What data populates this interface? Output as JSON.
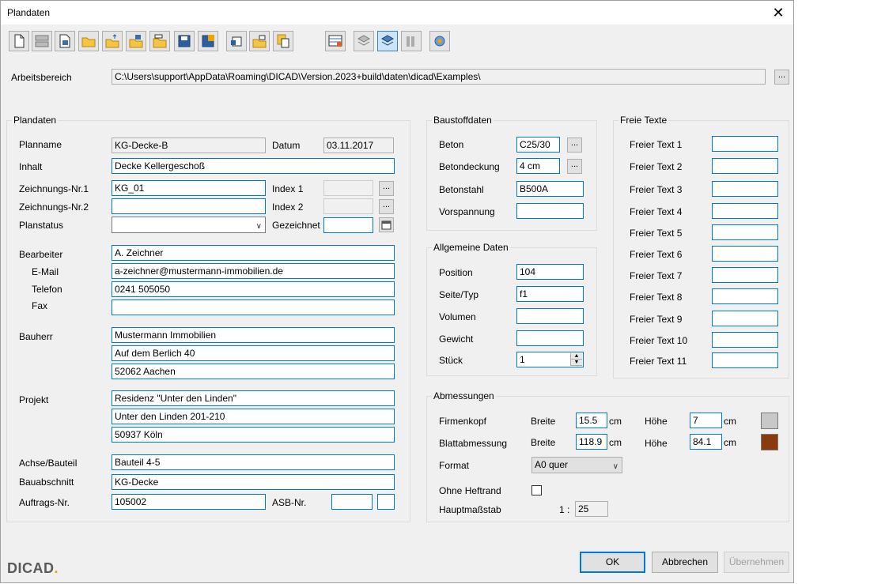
{
  "window": {
    "title": "Plandaten",
    "close_glyph": "✕"
  },
  "toolbar": {
    "icons": [
      "new-icon",
      "layout-icon",
      "document-icon",
      "open-folder-icon",
      "open-folder-up-icon",
      "open-folder-multi-icon",
      "open-folder-arrow-icon",
      "save-icon",
      "save-as-icon",
      "export-icon",
      "import-folder-icon",
      "copy-icon",
      "table-edit-icon",
      "stack-icon",
      "view-icon",
      "columns-icon",
      "settings-icon"
    ]
  },
  "arbeitsbereich": {
    "label": "Arbeitsbereich",
    "path": "C:\\Users\\support\\AppData\\Roaming\\DICAD\\Version.2023+build\\daten\\dicad\\Examples\\",
    "browse": "..."
  },
  "plandaten": {
    "title": "Plandaten",
    "planname_label": "Planname",
    "planname": "KG-Decke-B",
    "datum_label": "Datum",
    "datum": "03.11.2017",
    "inhalt_label": "Inhalt",
    "inhalt": "Decke Kellergeschoß",
    "znr1_label": "Zeichnungs-Nr.1",
    "znr1": "KG_01",
    "index1_label": "Index 1",
    "index1": "",
    "znr2_label": "Zeichnungs-Nr.2",
    "znr2": "",
    "index2_label": "Index 2",
    "index2": "",
    "planstatus_label": "Planstatus",
    "planstatus": "",
    "gezeichnet_label": "Gezeichnet",
    "gezeichnet": "",
    "bearbeiter_label": "Bearbeiter",
    "bearbeiter": "A. Zeichner",
    "email_label": "E-Mail",
    "email": "a-zeichner@mustermann-immobilien.de",
    "telefon_label": "Telefon",
    "telefon": "0241 505050",
    "fax_label": "Fax",
    "fax": "",
    "bauherr_label": "Bauherr",
    "bauherr_lines": [
      "Mustermann Immobilien",
      "Auf dem Berlich 40",
      "52062 Aachen"
    ],
    "projekt_label": "Projekt",
    "projekt_lines": [
      "Residenz \"Unter den Linden\"",
      "Unter den Linden 201-210",
      "50937 Köln"
    ],
    "achse_label": "Achse/Bauteil",
    "achse": "Bauteil 4-5",
    "bauabschnitt_label": "Bauabschnitt",
    "bauabschnitt": "KG-Decke",
    "auftrag_label": "Auftrags-Nr.",
    "auftrag": "105002",
    "asb_label": "ASB-Nr.",
    "asb": "",
    "asb2": "",
    "dots": "..."
  },
  "baustoff": {
    "title": "Baustoffdaten",
    "beton_label": "Beton",
    "beton": "C25/30",
    "betondeckung_label": "Betondeckung",
    "betondeckung": "4 cm",
    "betonstahl_label": "Betonstahl",
    "betonstahl": "B500A",
    "vorspannung_label": "Vorspannung",
    "vorspannung": "",
    "dots": "..."
  },
  "allgemein": {
    "title": "Allgemeine Daten",
    "position_label": "Position",
    "position": "104",
    "seite_label": "Seite/Typ",
    "seite": "f1",
    "volumen_label": "Volumen",
    "volumen": "",
    "gewicht_label": "Gewicht",
    "gewicht": "",
    "stueck_label": "Stück",
    "stueck": "1"
  },
  "freie": {
    "title": "Freie Texte",
    "items": [
      {
        "label": "Freier Text 1",
        "value": ""
      },
      {
        "label": "Freier Text 2",
        "value": ""
      },
      {
        "label": "Freier Text 3",
        "value": ""
      },
      {
        "label": "Freier Text 4",
        "value": ""
      },
      {
        "label": "Freier Text 5",
        "value": ""
      },
      {
        "label": "Freier Text 6",
        "value": ""
      },
      {
        "label": "Freier Text 7",
        "value": ""
      },
      {
        "label": "Freier Text 8",
        "value": ""
      },
      {
        "label": "Freier Text 9",
        "value": ""
      },
      {
        "label": "Freier Text 10",
        "value": ""
      },
      {
        "label": "Freier Text 11",
        "value": ""
      }
    ]
  },
  "abmessungen": {
    "title": "Abmessungen",
    "firmenkopf_label": "Firmenkopf",
    "blatt_label": "Blattabmessung",
    "breite_label": "Breite",
    "hoehe_label": "Höhe",
    "cm": "cm",
    "fk_breite": "15.5",
    "fk_hoehe": "7",
    "fk_color": "#c8c8c8",
    "bl_breite": "118.9",
    "bl_hoehe": "84.1",
    "bl_color": "#8b3a0f",
    "format_label": "Format",
    "format": "A0 quer",
    "heftrand_label": "Ohne Heftrand",
    "heftrand_checked": false,
    "massstab_label": "Hauptmaßstab",
    "massstab_prefix": "1 :",
    "massstab": "25"
  },
  "buttons": {
    "ok": "OK",
    "cancel": "Abbrechen",
    "apply": "Übernehmen"
  },
  "logo": {
    "text": "DICAD",
    "dot": "."
  }
}
